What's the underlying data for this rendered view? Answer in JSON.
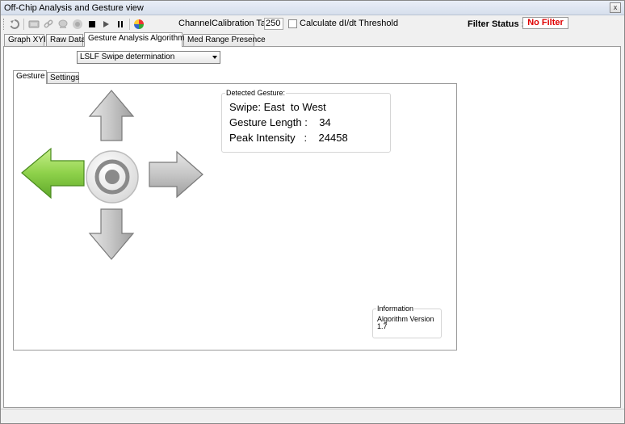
{
  "window": {
    "title": "Off-Chip Analysis and Gesture view",
    "close_glyph": "x"
  },
  "toolbar": {
    "icons": [
      "refresh-icon",
      "keyboard-icon",
      "link-icon",
      "device-icon",
      "record-icon",
      "stop-icon",
      "play-icon",
      "pause-icon",
      "color-wheel-icon"
    ],
    "channel_label": "ChannelCalibration Target",
    "channel_value": "250",
    "calc_checkbox_label": "Calculate dI/dt Threshold",
    "calc_checked": false,
    "filter_status_label": "Filter Status :",
    "filter_status_value": "No Filter"
  },
  "tabs": [
    {
      "label": "Graph XYI",
      "active": false
    },
    {
      "label": "Raw Data",
      "active": false
    },
    {
      "label": "Gesture Analysis Algorithm",
      "active": true
    },
    {
      "label": "Med Range Presence",
      "active": false
    }
  ],
  "algorithm_select": {
    "value": "LSLF Swipe determination"
  },
  "subtabs": [
    {
      "label": "Gesture",
      "active": true
    },
    {
      "label": "Settings",
      "active": false
    }
  ],
  "gesture_display": {
    "active_direction": "left",
    "colors": {
      "active": "#7cc242",
      "inactive": "#b8b8b8"
    }
  },
  "detected": {
    "title": "Detected Gesture:",
    "swipe": "Swipe: East  to West",
    "length": "Gesture Length :    34",
    "intensity": "Peak Intensity   :    24458"
  },
  "information": {
    "title": "Information",
    "line1": "Algorithm Version",
    "line2": "1.7"
  }
}
